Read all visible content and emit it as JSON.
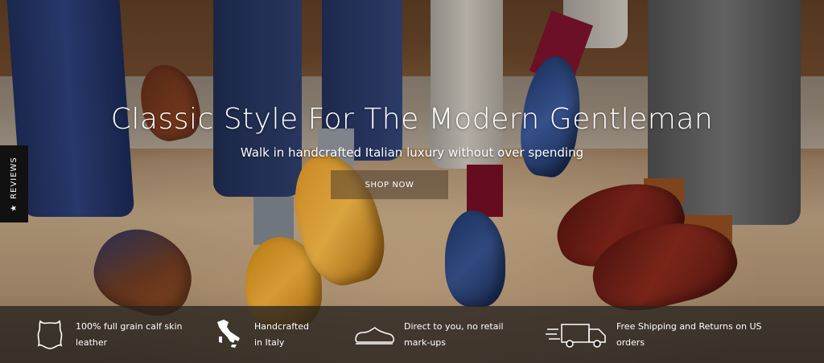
{
  "hero": {
    "headline": "Classic Style For The Modern Gentleman",
    "subheadline": "Walk in handcrafted Italian luxury without over spending",
    "cta_label": "SHOP NOW"
  },
  "reviews_tab": {
    "label": "REVIEWS",
    "icon": "star-icon"
  },
  "features": [
    {
      "icon": "leather-hide-icon",
      "line1": "100% full grain calf skin",
      "line2": "leather"
    },
    {
      "icon": "italy-map-icon",
      "line1": "Handcrafted",
      "line2": "in Italy"
    },
    {
      "icon": "shoe-icon",
      "line1": "Direct to you, no retail",
      "line2": "mark-ups"
    },
    {
      "icon": "delivery-truck-icon",
      "line1": "Free Shipping and Returns on US",
      "line2": "orders"
    }
  ],
  "colors": {
    "feature_bar": "#28221e",
    "cta_bg": "#503e2d",
    "reviews_tab_bg": "#111111",
    "text": "#ffffff"
  }
}
